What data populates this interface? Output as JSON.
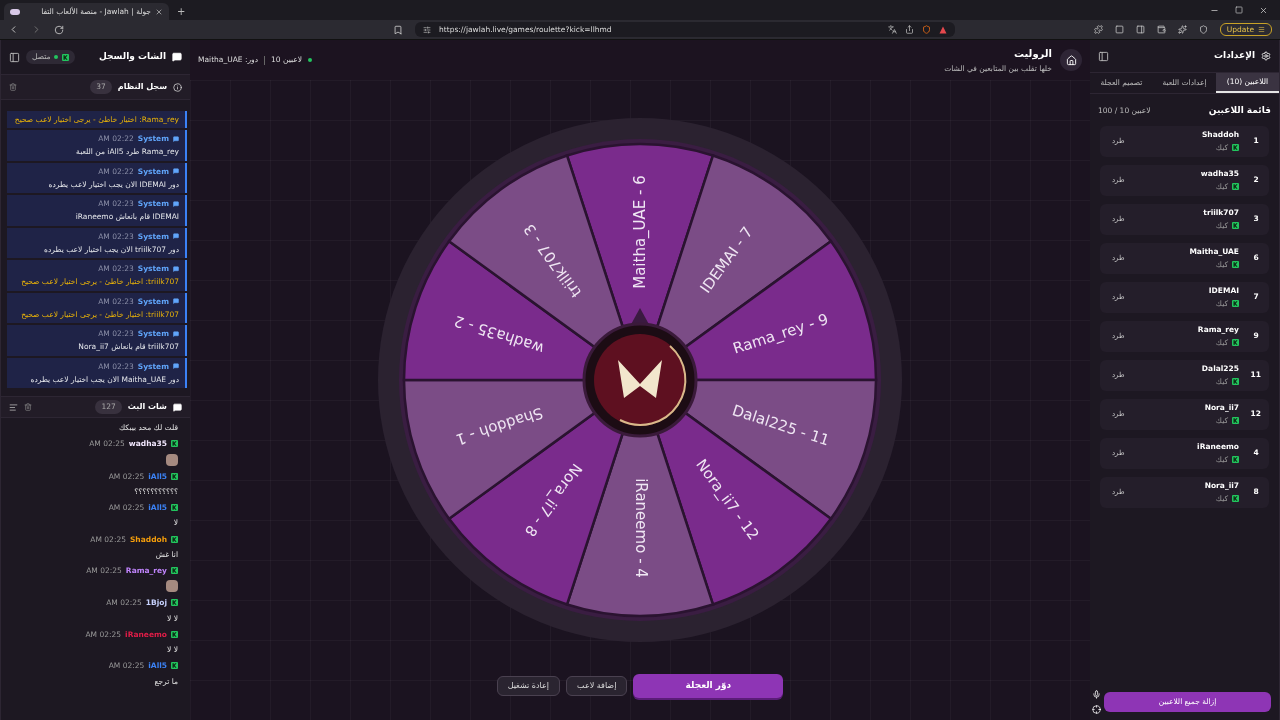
{
  "browser": {
    "tab_title": "جولة | Jawlah - منصة الألعاب التفا",
    "new_tab": "+",
    "url": "https://jawlah.live/games/roulette?kick=llhmd",
    "update": "Update"
  },
  "chat_panel": {
    "title": "الشات والسجل",
    "status": "متصل",
    "online": true,
    "system_log": {
      "title": "سجل النظام",
      "count": "37",
      "entries": [
        {
          "kind": "warning",
          "text": "Rama_rey: اختيار خاطئ - يرجى اختيار لاعب صحيح"
        },
        {
          "kind": "info",
          "sender": "System",
          "time": "02:22 AM",
          "text": "Rama_rey طرد iAll5 من اللعبة"
        },
        {
          "kind": "info",
          "sender": "System",
          "time": "02:22 AM",
          "text": "دور IDEMAI الان يجب اختيار لاعب يطرده"
        },
        {
          "kind": "info",
          "sender": "System",
          "time": "02:23 AM",
          "text": "IDEMAI قام بانعاش iRaneemo"
        },
        {
          "kind": "info",
          "sender": "System",
          "time": "02:23 AM",
          "text": "دور triilk707 الان يجب اختيار لاعب يطرده"
        },
        {
          "kind": "warning",
          "sender": "System",
          "time": "02:23 AM",
          "text": "triilk707: اختيار خاطئ - يرجى اختيار لاعب صحيح"
        },
        {
          "kind": "warning",
          "sender": "System",
          "time": "02:23 AM",
          "text": "triilk707: اختيار خاطئ - يرجى اختيار لاعب صحيح"
        },
        {
          "kind": "info",
          "sender": "System",
          "time": "02:23 AM",
          "text": "triilk707 قام بانعاش Nora_ii7"
        },
        {
          "kind": "info",
          "sender": "System",
          "time": "02:23 AM",
          "text": "دور Maitha_UAE الان يجب اختيار لاعب يطرده"
        }
      ]
    },
    "stream_chat": {
      "title": "شات البث",
      "count": "127",
      "messages": [
        {
          "kind": "text",
          "text": "قلت لك محد بيبكك"
        },
        {
          "kind": "emote",
          "user": "wadha35",
          "color": "#f3e8ff",
          "time": "02:25 AM"
        },
        {
          "kind": "text",
          "user": "iAll5",
          "color": "#3b82f6",
          "time": "02:25 AM",
          "text": "؟؟؟؟؟؟؟؟؟؟؟"
        },
        {
          "kind": "text",
          "user": "iAll5",
          "color": "#3b82f6",
          "time": "02:25 AM",
          "text": "لا"
        },
        {
          "kind": "text",
          "user": "Shaddoh",
          "color": "#f59e0b",
          "time": "02:25 AM",
          "text": "انا غش"
        },
        {
          "kind": "emote",
          "user": "Rama_rey",
          "color": "#c084fc",
          "time": "02:25 AM"
        },
        {
          "kind": "text",
          "user": "1Bjoj",
          "color": "#c7d2fe",
          "time": "02:25 AM",
          "text": "لا لا"
        },
        {
          "kind": "text",
          "user": "iRaneemo",
          "color": "#e11d48",
          "time": "02:25 AM",
          "text": "لا لا"
        },
        {
          "kind": "text",
          "user": "iAll5",
          "color": "#3b82f6",
          "time": "02:25 AM",
          "text": "ما ترجع"
        }
      ]
    }
  },
  "game": {
    "title": "الروليت",
    "subtitle": "خلها تقلب بين المتابعين في الشات",
    "players_count": "10 لاعبين",
    "turn": "دور: Maitha_UAE",
    "wheel": {
      "segments": [
        {
          "label": "Maitha_UAE - 6",
          "color": "#7a2b8c"
        },
        {
          "label": "IDEMAI - 7",
          "color": "#7b4c86"
        },
        {
          "label": "Rama_rey - 9",
          "color": "#7a2b8c"
        },
        {
          "label": "Dalal225 - 11",
          "color": "#7b4c86"
        },
        {
          "label": "Nora_ii7 - 12",
          "color": "#7a2b8c"
        },
        {
          "label": "iRaneemo - 4",
          "color": "#7b4c86"
        },
        {
          "label": "Nora_ii7 - 8",
          "color": "#7a2b8c"
        },
        {
          "label": "Shaddoh - 1",
          "color": "#7b4c86"
        },
        {
          "label": "wadha35 - 2",
          "color": "#7a2b8c"
        },
        {
          "label": "triilk707 - 3",
          "color": "#7b4c86"
        }
      ]
    },
    "buttons": [
      {
        "label": "دوّر العجلة",
        "kind": "primary"
      },
      {
        "label": "إضافة لاعب",
        "kind": "secondary"
      },
      {
        "label": "إعادة تشغيل",
        "kind": "secondary"
      }
    ]
  },
  "settings": {
    "title": "الإعدادات",
    "tabs": [
      {
        "label": "اللاعبين (10)",
        "selected": true
      },
      {
        "label": "إعدادات اللعبة",
        "selected": false
      },
      {
        "label": "تصميم العجلة",
        "selected": false
      }
    ],
    "list_title": "قائمة اللاعبين",
    "capacity": "100 / 10 لاعبين",
    "players": [
      {
        "rank": "1",
        "name": "Shaddoh",
        "platform": "كيك",
        "action": "طرد"
      },
      {
        "rank": "2",
        "name": "wadha35",
        "platform": "كيك",
        "action": "طرد"
      },
      {
        "rank": "3",
        "name": "triilk707",
        "platform": "كيك",
        "action": "طرد"
      },
      {
        "rank": "6",
        "name": "Maitha_UAE",
        "platform": "كيك",
        "action": "طرد"
      },
      {
        "rank": "7",
        "name": "IDEMAI",
        "platform": "كيك",
        "action": "طرد"
      },
      {
        "rank": "9",
        "name": "Rama_rey",
        "platform": "كيك",
        "action": "طرد"
      },
      {
        "rank": "11",
        "name": "Dalal225",
        "platform": "كيك",
        "action": "طرد"
      },
      {
        "rank": "12",
        "name": "Nora_ii7",
        "platform": "كيك",
        "action": "طرد"
      },
      {
        "rank": "4",
        "name": "iRaneemo",
        "platform": "كيك",
        "action": "طرد"
      },
      {
        "rank": "8",
        "name": "Nora_ii7",
        "platform": "كيك",
        "action": "طرد"
      }
    ],
    "remove_all": "إزالة جميع اللاعبين"
  }
}
